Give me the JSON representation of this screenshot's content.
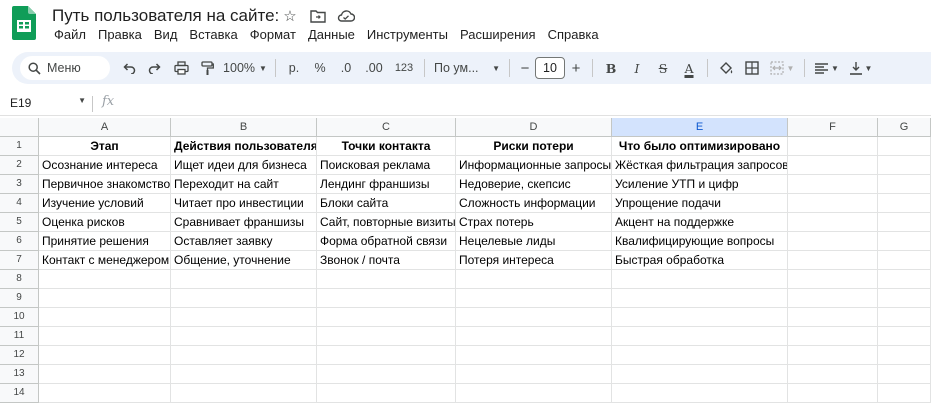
{
  "app": {
    "doc_title": "Путь пользователя на сайте:",
    "menu": [
      "Файл",
      "Правка",
      "Вид",
      "Вставка",
      "Формат",
      "Данные",
      "Инструменты",
      "Расширения",
      "Справка"
    ]
  },
  "toolbar": {
    "search_label": "Меню",
    "zoom": "100%",
    "currency": "р.",
    "percent": "%",
    "dec_decrease": ".0",
    "dec_increase": ".00",
    "number_format": "123",
    "font_name": "По ум...",
    "font_size": "10",
    "bold": "B",
    "italic": "I",
    "strike": "S",
    "text_color": "A",
    "minus": "−",
    "plus": "+"
  },
  "formula_bar": {
    "name_box": "E19",
    "fx": "fx"
  },
  "sheet": {
    "columns": [
      "A",
      "B",
      "C",
      "D",
      "E",
      "F",
      "G"
    ],
    "row_numbers": [
      "1",
      "2",
      "3",
      "4",
      "5",
      "6",
      "7",
      "8",
      "9",
      "10",
      "11",
      "12",
      "13",
      "14"
    ],
    "rows": [
      [
        "Этап",
        "Действия пользователя",
        "Точки контакта",
        "Риски потери",
        "Что было оптимизировано"
      ],
      [
        "Осознание интереса",
        "Ищет идеи для бизнеса",
        "Поисковая реклама",
        "Информационные запросы",
        "Жёсткая фильтрация запросов"
      ],
      [
        "Первичное знакомство",
        "Переходит на сайт",
        "Лендинг франшизы",
        "Недоверие, скепсис",
        "Усиление УТП и цифр"
      ],
      [
        "Изучение условий",
        "Читает про инвестиции",
        "Блоки сайта",
        "Сложность информации",
        "Упрощение подачи"
      ],
      [
        "Оценка рисков",
        "Сравнивает франшизы",
        "Сайт, повторные визиты",
        "Страх потерь",
        "Акцент на поддержке"
      ],
      [
        "Принятие решения",
        "Оставляет заявку",
        "Форма обратной связи",
        "Нецелевые лиды",
        "Квалифицирующие вопросы"
      ],
      [
        "Контакт с менеджером",
        "Общение, уточнение",
        "Звонок / почта",
        "Потеря интереса",
        "Быстрая обработка"
      ]
    ],
    "selected_column": "E"
  }
}
